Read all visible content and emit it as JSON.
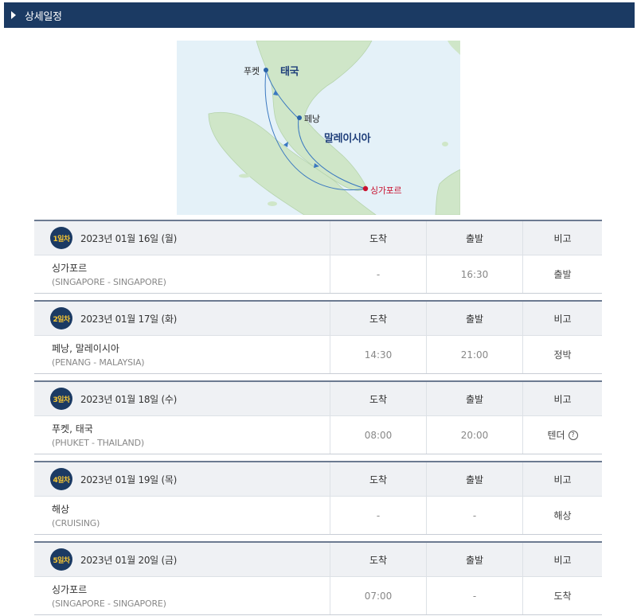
{
  "header": {
    "title": "상세일정",
    "toggle_icon": "triangle-right-icon"
  },
  "map": {
    "labels": {
      "phuket": "푸켓",
      "thailand": "태국",
      "penang": "페낭",
      "malaysia": "말레이시아",
      "singapore": "싱가포르"
    },
    "colors": {
      "sea": "#e4f1f8",
      "land": "#cfe6c8",
      "route": "#3a78c0",
      "start": "#c8102e"
    }
  },
  "columns": {
    "arrival": "도착",
    "departure": "출발",
    "note": "비고"
  },
  "days": [
    {
      "badge": "1일차",
      "date": "2023년 01월 16일 (월)",
      "port": "싱가포르",
      "port_en": "(SINGAPORE - SINGAPORE)",
      "arrival": "-",
      "departure": "16:30",
      "note": "출발"
    },
    {
      "badge": "2일차",
      "date": "2023년 01월 17일 (화)",
      "port": "페낭, 말레이시아",
      "port_en": "(PENANG - MALAYSIA)",
      "arrival": "14:30",
      "departure": "21:00",
      "note": "정박"
    },
    {
      "badge": "3일차",
      "date": "2023년 01월 18일 (수)",
      "port": "푸켓, 태국",
      "port_en": "(PHUKET - THAILAND)",
      "arrival": "08:00",
      "departure": "20:00",
      "note": "텐더",
      "note_help": "?"
    },
    {
      "badge": "4일차",
      "date": "2023년 01월 19일 (목)",
      "port": "해상",
      "port_en": "(CRUISING)",
      "arrival": "-",
      "departure": "-",
      "note": "해상"
    },
    {
      "badge": "5일차",
      "date": "2023년 01월 20일 (금)",
      "port": "싱가포르",
      "port_en": "(SINGAPORE - SINGAPORE)",
      "arrival": "07:00",
      "departure": "-",
      "note": "도착"
    }
  ]
}
